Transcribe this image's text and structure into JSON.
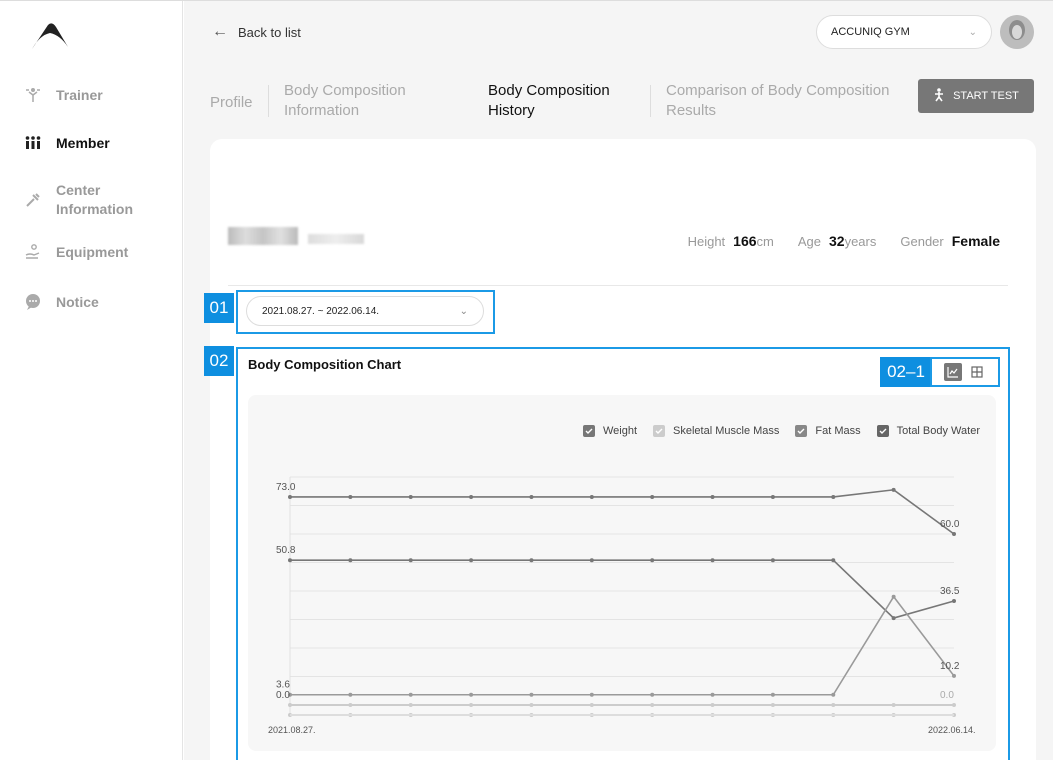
{
  "sidebar": {
    "items": [
      {
        "label": "Trainer",
        "icon": "dumbbell-person-icon",
        "active": false
      },
      {
        "label": "Member",
        "icon": "people-icon",
        "active": true
      },
      {
        "label": "Center",
        "label2": "Information",
        "icon": "tools-icon",
        "active": false
      },
      {
        "label": "Equipment",
        "icon": "hand-person-icon",
        "active": false
      },
      {
        "label": "Notice",
        "icon": "chat-bubble-icon",
        "active": false
      }
    ]
  },
  "header": {
    "back_label": "Back to list",
    "gym_select": "ACCUNIQ GYM",
    "start_test_label": "START TEST"
  },
  "tabs": [
    {
      "line1": "Profile",
      "line2": ""
    },
    {
      "line1": "Body Composition",
      "line2": "Information"
    },
    {
      "line1": "Body Composition",
      "line2": "History"
    },
    {
      "line1": "Comparison of Body Composition",
      "line2": "Results"
    }
  ],
  "member": {
    "height_label": "Height",
    "height_value": "166",
    "height_unit": "cm",
    "age_label": "Age",
    "age_value": "32",
    "age_unit": "years",
    "gender_label": "Gender",
    "gender_value": "Female"
  },
  "annotations": {
    "badge_01": "01",
    "badge_02": "02",
    "badge_02_1": "02–1"
  },
  "date_range": "2021.08.27. ~ 2022.06.14.",
  "colors": {
    "accent_blue": "#1b9ae6",
    "badge_blue": "#0e8fe0",
    "line_dark": "#777777",
    "line_light": "#9a9a9a"
  },
  "chart_data": {
    "type": "line",
    "title": "Body Composition Chart",
    "legend": [
      {
        "name": "Weight",
        "checked": true
      },
      {
        "name": "Skeletal Muscle Mass",
        "checked": true
      },
      {
        "name": "Fat Mass",
        "checked": true
      },
      {
        "name": "Total Body Water",
        "checked": true
      }
    ],
    "x_start_label": "2021.08.27.",
    "x_end_label": "2022.06.14.",
    "point_count": 12,
    "series": [
      {
        "values": [
          73.0,
          73.0,
          73.0,
          73.0,
          73.0,
          73.0,
          73.0,
          73.0,
          73.0,
          73.0,
          75.5,
          60.0
        ],
        "first_label": "73.0",
        "last_label": "60.0",
        "color": "#777777"
      },
      {
        "values": [
          50.8,
          50.8,
          50.8,
          50.8,
          50.8,
          50.8,
          50.8,
          50.8,
          50.8,
          50.8,
          30.5,
          36.5
        ],
        "first_label": "50.8",
        "last_label": "36.5",
        "color": "#777777"
      },
      {
        "values": [
          3.6,
          3.6,
          3.6,
          3.6,
          3.6,
          3.6,
          3.6,
          3.6,
          3.6,
          3.6,
          38.0,
          10.2
        ],
        "first_label": "3.6",
        "last_label": "10.2",
        "color": "#9a9a9a"
      },
      {
        "values": [
          0.0,
          0.0,
          0.0,
          0.0,
          0.0,
          0.0,
          0.0,
          0.0,
          0.0,
          0.0,
          0.0,
          0.0
        ],
        "first_label": "0.0",
        "last_label": "0.0",
        "color": "#cccccc"
      }
    ],
    "ylim": [
      0,
      80
    ],
    "grid": true,
    "legend_position": "top-right"
  }
}
